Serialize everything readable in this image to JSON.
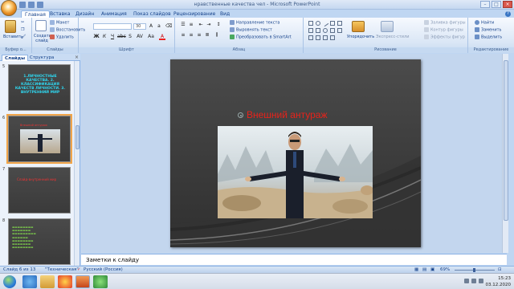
{
  "window": {
    "title": "нравственные качества чел  -  Microsoft PowerPoint",
    "controls": [
      "–",
      "□",
      "×"
    ]
  },
  "tabs": [
    "Главная",
    "Вставка",
    "Дизайн",
    "Анимация",
    "Показ слайдов",
    "Рецензирование",
    "Вид"
  ],
  "ribbon": {
    "clipboard": {
      "paste": "Вставить",
      "label": "Буфер о..."
    },
    "slides": {
      "new_slide": "Создать слайд",
      "layout": "Макет",
      "reset": "Восстановить",
      "delete": "Удалить",
      "label": "Слайды"
    },
    "font": {
      "font_name": "",
      "font_size": "30",
      "label": "Шрифт"
    },
    "paragraph": {
      "text_direction": "Направление текста",
      "align_text": "Выровнять текст",
      "convert_smartart": "Преобразовать в SmartArt",
      "label": "Абзац"
    },
    "drawing": {
      "arrange": "Упорядочить",
      "quick_styles": "Экспресс-стили",
      "shape_fill": "Заливка фигуры",
      "shape_outline": "Контур фигуры",
      "shape_effects": "Эффекты фигур",
      "label": "Рисование"
    },
    "editing": {
      "find": "Найти",
      "replace": "Заменить",
      "select": "Выделить",
      "label": "Редактирование"
    }
  },
  "left_pane": {
    "tabs": [
      "Слайды",
      "Структура"
    ],
    "close": "×",
    "thumbnails": [
      {
        "number": "5",
        "text": "1.ЛИЧНОСТНЫЕ КАЧЕСТВА. 2. КЛАССИФИКАЦИЯ КАЧЕСТВ ЛИЧНОСТИ. 3. ВНУТРЕННИЙ МИР",
        "kind": "text"
      },
      {
        "number": "6",
        "text": "Внешний антураж",
        "kind": "photo",
        "selected": true
      },
      {
        "number": "7",
        "text": "Слайд-внутренний мир",
        "kind": "red"
      },
      {
        "number": "8",
        "text": "список",
        "kind": "list"
      }
    ]
  },
  "slide": {
    "title": "Внешний антураж",
    "title_color": "#e8221a",
    "background": "#3c3c3c"
  },
  "notes": {
    "placeholder": "Заметки к слайду"
  },
  "status": {
    "slide_info": "Слайд 6 из 13",
    "theme": "\"Техническая\"",
    "language": "Русский (Россия)",
    "zoom": "69%"
  },
  "taskbar": {
    "time": "15:23",
    "date": "03.12.2020"
  }
}
